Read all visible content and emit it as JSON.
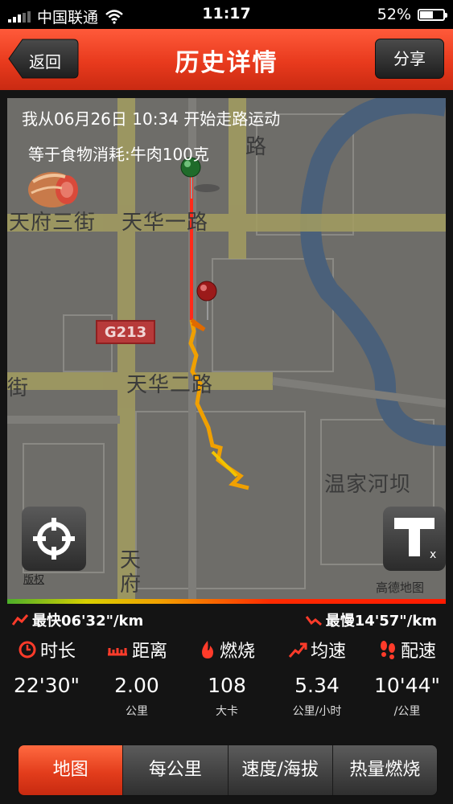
{
  "status_bar": {
    "carrier": "中国联通",
    "time": "11:17",
    "battery": "52%",
    "battery_level": 0.52
  },
  "header": {
    "title": "历史详情",
    "back_label": "返回",
    "share_label": "分享"
  },
  "map": {
    "start_info": "我从06月26日 10:34 开始走路运动",
    "food_info": "等于食物消耗:牛肉100克",
    "labels": {
      "street1": "天府三街",
      "street2": "天华一路",
      "street3": "天华二路",
      "road_vertical": "路",
      "road_left": "街",
      "area": "温家河坝",
      "road_bottom": "天府",
      "highway": "G213"
    },
    "copyright": "版权",
    "provider": "高德地图"
  },
  "speed": {
    "fastest": "最快06'32\"/km",
    "slowest": "最慢14'57\"/km"
  },
  "stats": [
    {
      "label": "时长",
      "value": "22'30\"",
      "unit": "",
      "icon": "clock-icon",
      "color": "#ff3b2a"
    },
    {
      "label": "距离",
      "value": "2.00",
      "unit": "公里",
      "icon": "ruler-icon",
      "color": "#ff3b2a"
    },
    {
      "label": "燃烧",
      "value": "108",
      "unit": "大卡",
      "icon": "flame-icon",
      "color": "#ff3b2a"
    },
    {
      "label": "均速",
      "value": "5.34",
      "unit": "公里/小时",
      "icon": "trend-arrow-icon",
      "color": "#ff3b2a"
    },
    {
      "label": "配速",
      "value": "10'44\"",
      "unit": "/公里",
      "icon": "footprints-icon",
      "color": "#ff3b2a"
    }
  ],
  "tabs": [
    {
      "label": "地图",
      "active": true
    },
    {
      "label": "每公里",
      "active": false
    },
    {
      "label": "速度/海拔",
      "active": false
    },
    {
      "label": "热量燃烧",
      "active": false
    }
  ],
  "colors": {
    "accent": "#e83a1d",
    "route_start": "#ff2a1a",
    "route_end": "#f2b400"
  }
}
